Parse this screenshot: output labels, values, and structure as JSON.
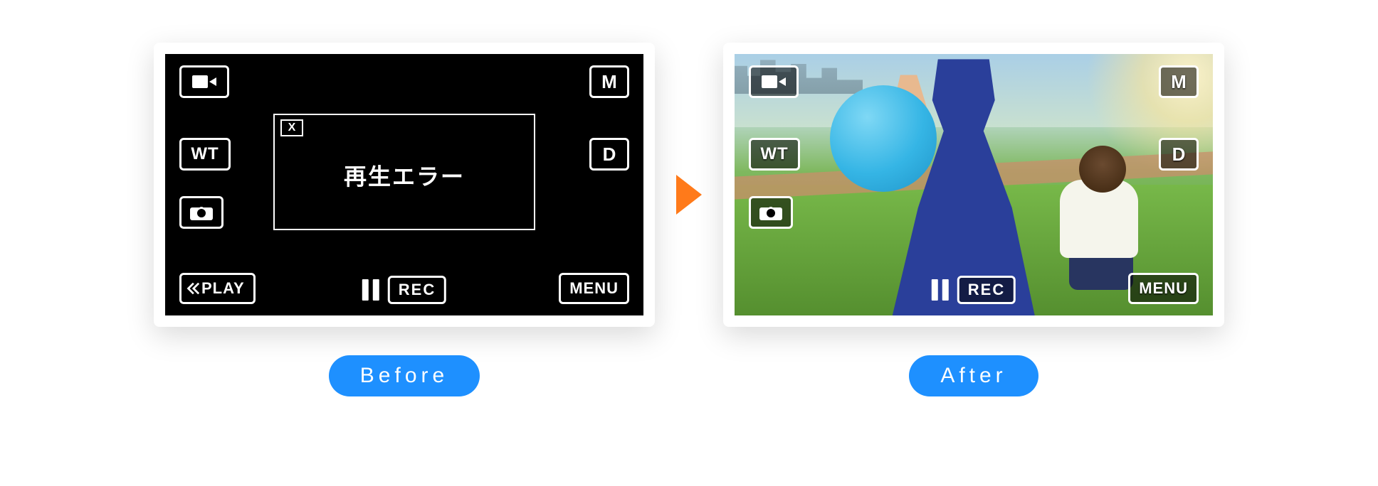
{
  "labels": {
    "before": "Before",
    "after": "After"
  },
  "camera": {
    "wt": "WT",
    "m": "M",
    "d": "D",
    "play": "PLAY",
    "menu": "MENU",
    "rec": "REC"
  },
  "error": {
    "close": "X",
    "message": "再生エラー"
  }
}
